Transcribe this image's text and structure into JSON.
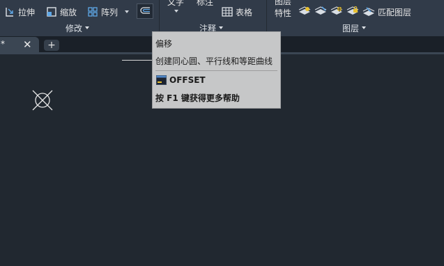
{
  "ribbon": {
    "modify": {
      "stretch_label": "拉伸",
      "scale_label": "缩放",
      "array_label": "阵列",
      "panel_title": "修改"
    },
    "annotation": {
      "text_label": "文字",
      "dimension_label": "标注",
      "table_label": "表格",
      "panel_title": "注释"
    },
    "layers": {
      "properties_label_line1": "图层",
      "properties_label_line2": "特性",
      "match_label": "匹配图层",
      "panel_title": "图层"
    }
  },
  "tabs": {
    "document_tab_label": "*",
    "close_glyph": "✕",
    "add_glyph": "+"
  },
  "tooltip": {
    "title": "偏移",
    "description": "创建同心圆、平行线和等距曲线",
    "command": "OFFSET",
    "help": "按 F1 键获得更多帮助"
  },
  "colors": {
    "ribbon_bg": "#313b49",
    "canvas_bg": "#212830",
    "tooltip_bg": "#c6c7c8",
    "accent_blue": "#5fa8e8",
    "bulb_yellow": "#e8c030"
  }
}
